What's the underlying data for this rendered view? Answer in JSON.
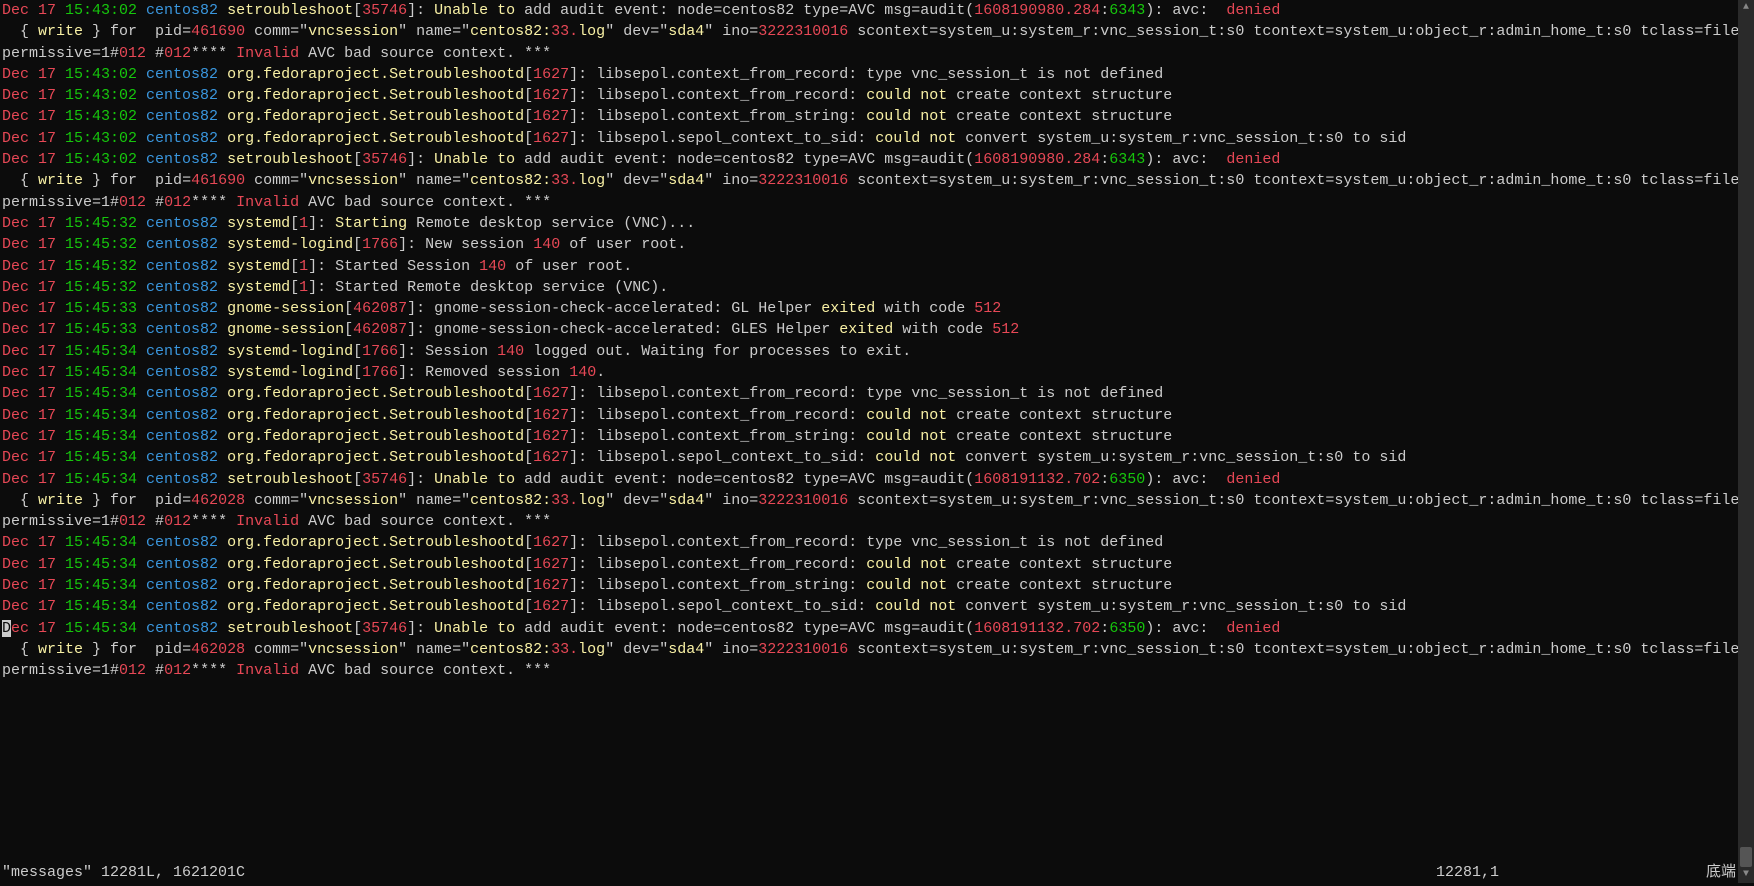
{
  "host": "centos82",
  "timestamps": {
    "t1": "Dec 17 15:43:02",
    "t2": "Dec 17 15:45:32",
    "t3": "Dec 17 15:45:33",
    "t4": "Dec 17 15:45:34"
  },
  "procs": {
    "setroubleshoot": "setroubleshoot",
    "setroubleshootd": "org.fedoraproject.Setroubleshootd",
    "systemd": "systemd",
    "logind": "systemd-logind",
    "gnome": "gnome-session"
  },
  "pids": {
    "setroubleshoot": "35746",
    "setroubleshootd": "1627",
    "systemd": "1",
    "logind": "1766",
    "gnome": "462087"
  },
  "audit": {
    "pid1": "461690",
    "pid2": "462028",
    "msg1": "1608190980.284",
    "msg1b": "6343",
    "msg2": "1608191132.702",
    "msg2b": "6350",
    "denied": "denied",
    "write": "write",
    "comm": "vncsession",
    "nameA": "centos82:",
    "nameB": "33.",
    "nameC": "log",
    "dev": "sda4",
    "ino": "3222310016",
    "oct": "012",
    "scontext": "scontext=system_u:system_r:vnc_session_t:s0 tcontext=system_u:object_r:admin_home_t:s0 tclass=file permissive=1#",
    "invalid": "Invalid",
    "avcbad": " AVC bad source context. ***"
  },
  "libsepol": {
    "rec_notdef": "libsepol.context_from_record: type vnc_session_t is not defined",
    "rec_pre": "libsepol.context_from_record: ",
    "couldnot": "could not",
    "rec_post": " create context structure",
    "str_pre": "libsepol.context_from_string: ",
    "sid_pre": "libsepol.sepol_context_to_sid: ",
    "sid_post": " convert system_u:system_r:vnc_session_t:s0 to sid"
  },
  "systemd_msgs": {
    "starting_vnc": "Starting Remote desktop service (VNC)...",
    "new_session_pre": "New session ",
    "session140": "140",
    "of_user_root": " of user root.",
    "started_session_pre": "Started Session ",
    "started_vnc": "Started Remote desktop service (VNC).",
    "gl_pre": "gnome-session-check-accelerated: GL Helper ",
    "gles_pre": "gnome-session-check-accelerated: GLES Helper ",
    "exited": "exited",
    "with_code": " with code ",
    "code512": "512",
    "logout_pre": "Session ",
    "logout_post": " logged out. Waiting for processes to exit.",
    "removed_pre": "Removed session ",
    "dot": "."
  },
  "misc": {
    "unable_add_pre": "Unable to",
    "unable_add_post": " add audit event: node=centos82 type=AVC msg=audit(",
    "paren_colon": "): avc:  ",
    "brace_for": "  { ",
    "brace_for2": " } for  pid=",
    "comm_eq": " comm=\"",
    "name_eq": "\" name=\"",
    "dev_eq": "\" dev=\"",
    "ino_eq": "\" ino=",
    "sp": " ",
    "hash": "#",
    "stars": "**** "
  },
  "status": {
    "file": "\"messages\" 12281L, 1621201C",
    "pos": "12281,1",
    "end": "底端"
  },
  "cursor": "D"
}
